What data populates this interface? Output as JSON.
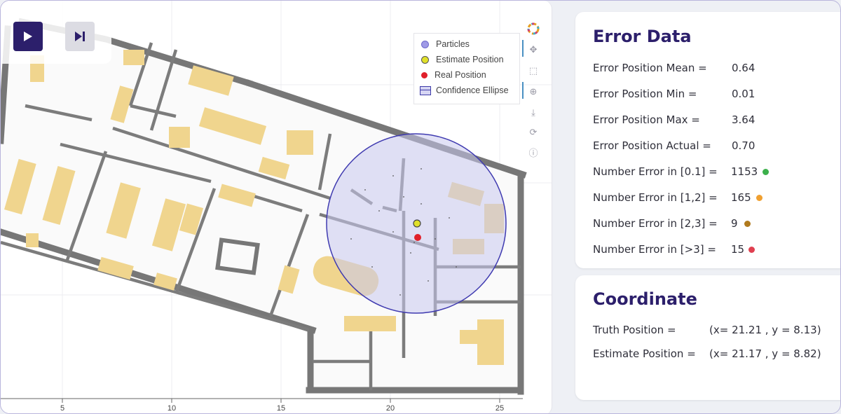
{
  "controls": {
    "play_icon": "play-icon",
    "step_icon": "step-forward-icon"
  },
  "legend": {
    "items": [
      {
        "label": "Particles",
        "color": "#9f9ae6"
      },
      {
        "label": "Estimate Position",
        "color": "#e0e02a"
      },
      {
        "label": "Real Position",
        "color": "#e0202a"
      },
      {
        "label": "Confidence Ellipse",
        "color": "#3e3ba8"
      }
    ]
  },
  "toolbar": [
    "bokeh-logo-icon",
    "pan-icon",
    "box-zoom-icon",
    "wheel-zoom-icon",
    "save-icon",
    "reset-icon",
    "help-icon"
  ],
  "map": {
    "x_ticks": [
      "5",
      "10",
      "15",
      "20",
      "25"
    ],
    "colors": {
      "wall": "#777777",
      "furniture": "#f0d58e",
      "ellipse_fill": "#c9c8ef",
      "ellipse_stroke": "#3f3ab0"
    }
  },
  "error_data": {
    "title": "Error Data",
    "rows": [
      {
        "label": "Error Position Mean =",
        "value": "0.64"
      },
      {
        "label": "Error Position Min =",
        "value": "0.01"
      },
      {
        "label": "Error Position Max =",
        "value": "3.64"
      },
      {
        "label": "Error Position Actual =",
        "value": "0.70"
      },
      {
        "label": "Number Error in [0.1] =",
        "value": "1153",
        "color": "#3cb04b"
      },
      {
        "label": "Number Error in [1,2] =",
        "value": "165",
        "color": "#f0a030"
      },
      {
        "label": "Number Error in [2,3] =",
        "value": "9",
        "color": "#b07a1e"
      },
      {
        "label": "Number Error in [>3] =",
        "value": "15",
        "color": "#e04050"
      }
    ]
  },
  "coordinate": {
    "title": "Coordinate",
    "rows": [
      {
        "label": "Truth Position =",
        "value": "(x= 21.21 , y = 8.13)"
      },
      {
        "label": "Estimate Position =",
        "value": "(x= 21.17 , y = 8.82)"
      }
    ]
  }
}
